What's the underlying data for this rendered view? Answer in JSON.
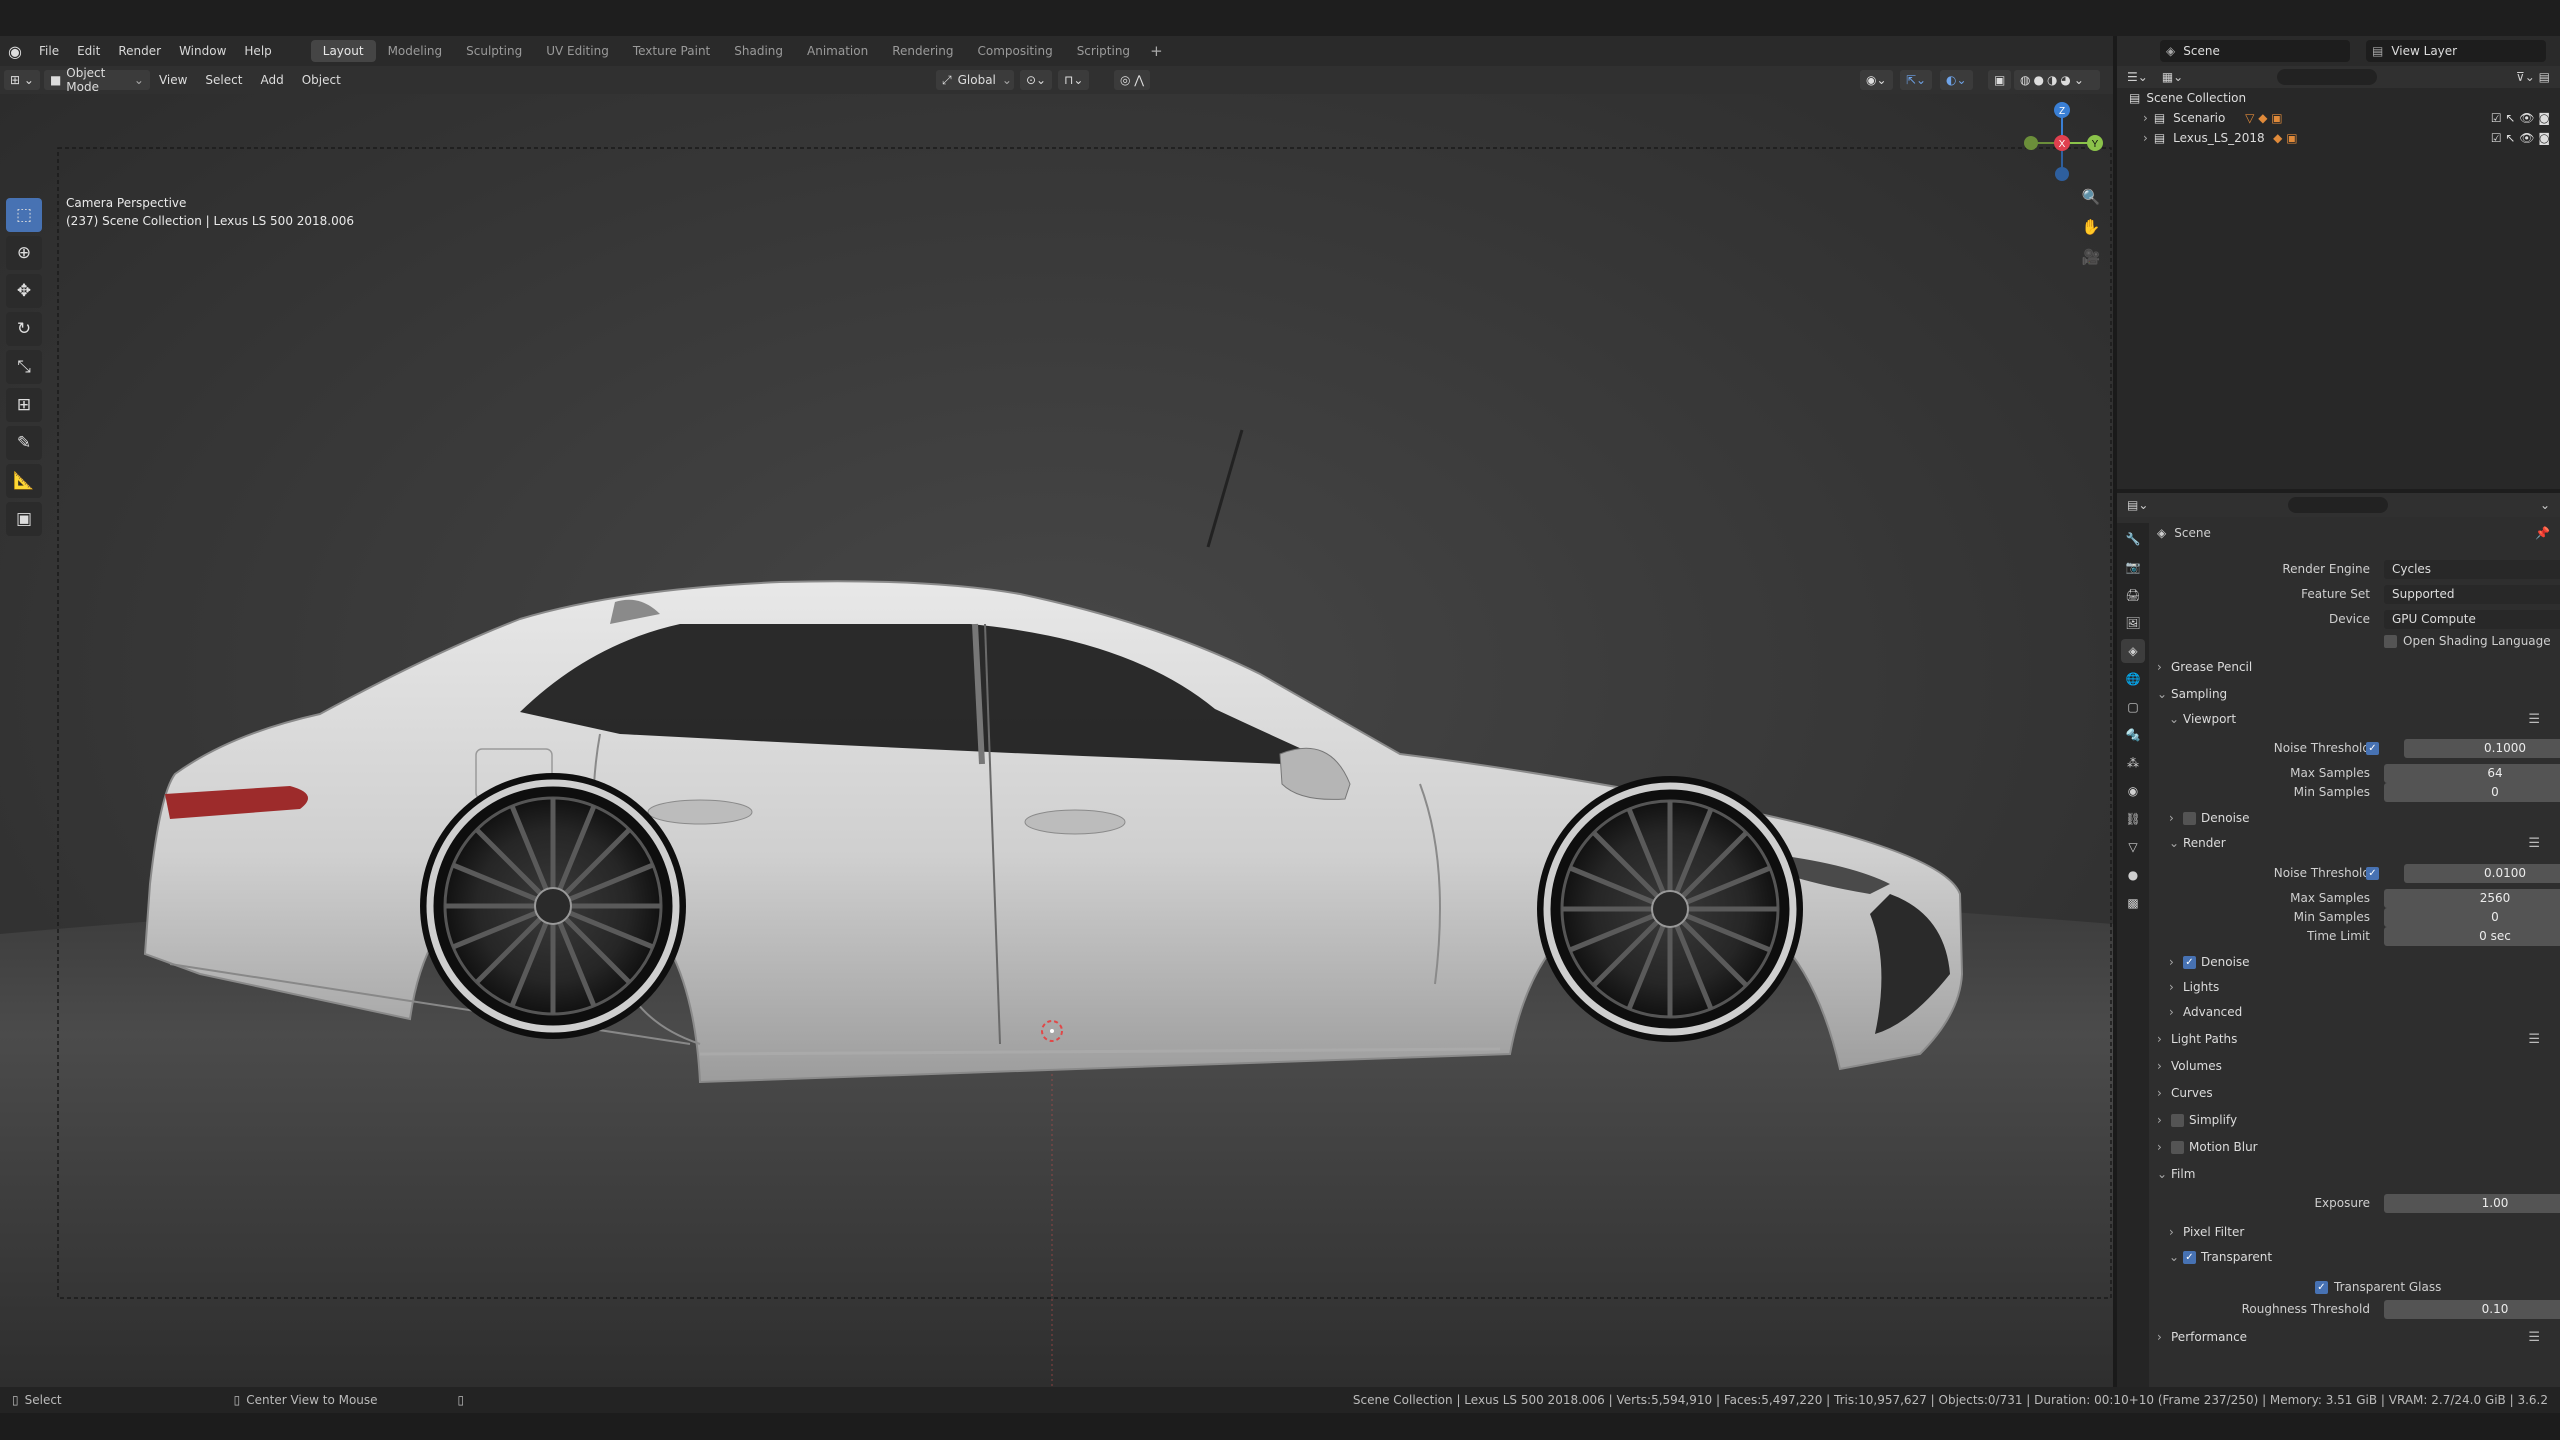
{
  "menubar": {
    "items": [
      "File",
      "Edit",
      "Render",
      "Window",
      "Help"
    ],
    "workspaces": [
      "Layout",
      "Modeling",
      "Sculpting",
      "UV Editing",
      "Texture Paint",
      "Shading",
      "Animation",
      "Rendering",
      "Compositing",
      "Scripting"
    ],
    "active_workspace": "Layout",
    "scene": "Scene",
    "view_layer": "View Layer"
  },
  "viewport_header": {
    "mode": "Object Mode",
    "menus": [
      "View",
      "Select",
      "Add",
      "Object"
    ],
    "orientation": "Global"
  },
  "viewport": {
    "title": "Camera Perspective",
    "subtitle": "(237) Scene Collection | Lexus LS 500 2018.006",
    "gizmo": {
      "x": "X",
      "y": "Y",
      "z": "Z"
    },
    "colors": {
      "background": "#3d3d3d",
      "ground": "#4a4a4a",
      "car_body": "#d6d6d6",
      "x_axis": "#e0404f",
      "y_axis": "#8bc34a",
      "z_axis": "#3a7fd5"
    }
  },
  "outliner": {
    "title": "Scene Collection",
    "items": [
      {
        "label": "Scenario"
      },
      {
        "label": "Lexus_LS_2018"
      }
    ]
  },
  "properties": {
    "context": "Scene",
    "render_engine_label": "Render Engine",
    "render_engine": "Cycles",
    "feature_set_label": "Feature Set",
    "feature_set": "Supported",
    "device_label": "Device",
    "device": "GPU Compute",
    "osl_label": "Open Shading Language",
    "grease_pencil": "Grease Pencil",
    "sampling": "Sampling",
    "viewport": "Viewport",
    "vp_noise_label": "Noise Threshold",
    "vp_noise": "0.1000",
    "vp_max_label": "Max Samples",
    "vp_max": "64",
    "vp_min_label": "Min Samples",
    "vp_min": "0",
    "denoise": "Denoise",
    "render": "Render",
    "r_noise_label": "Noise Threshold",
    "r_noise": "0.0100",
    "r_max_label": "Max Samples",
    "r_max": "2560",
    "r_min_label": "Min Samples",
    "r_min": "0",
    "r_time_label": "Time Limit",
    "r_time": "0 sec",
    "denoise2": "Denoise",
    "lights": "Lights",
    "advanced": "Advanced",
    "light_paths": "Light Paths",
    "volumes": "Volumes",
    "curves": "Curves",
    "simplify": "Simplify",
    "motion_blur": "Motion Blur",
    "film": "Film",
    "exposure_label": "Exposure",
    "exposure": "1.00",
    "pixel_filter": "Pixel Filter",
    "transparent": "Transparent",
    "transparent_glass": "Transparent Glass",
    "roughness_label": "Roughness Threshold",
    "roughness": "0.10",
    "performance": "Performance"
  },
  "statusbar": {
    "select": "Select",
    "center": "Center View to Mouse",
    "stats": "Scene Collection | Lexus LS 500 2018.006 | Verts:5,594,910 | Faces:5,497,220 | Tris:10,957,627 | Objects:0/731 | Duration: 00:10+10 (Frame 237/250) | Memory: 3.51 GiB | VRAM: 2.7/24.0 GiB | 3.6.2"
  }
}
